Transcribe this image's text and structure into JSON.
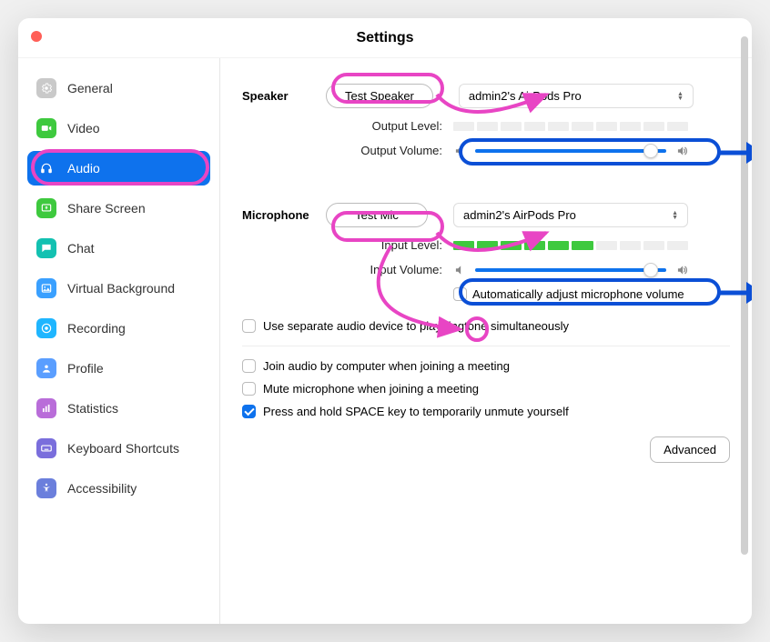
{
  "title": "Settings",
  "sidebar": {
    "items": [
      {
        "label": "General",
        "icon": "gear",
        "color": "#c9c9c9"
      },
      {
        "label": "Video",
        "icon": "video",
        "color": "#3ec93e"
      },
      {
        "label": "Audio",
        "icon": "headphones",
        "color": "#ffffff",
        "active": true
      },
      {
        "label": "Share Screen",
        "icon": "share",
        "color": "#3ec93e"
      },
      {
        "label": "Chat",
        "icon": "chat",
        "color": "#13c1b1"
      },
      {
        "label": "Virtual Background",
        "icon": "image",
        "color": "#3aa0ff"
      },
      {
        "label": "Recording",
        "icon": "record",
        "color": "#1fb6ff"
      },
      {
        "label": "Profile",
        "icon": "profile",
        "color": "#5a9eff"
      },
      {
        "label": "Statistics",
        "icon": "stats",
        "color": "#b96dd9"
      },
      {
        "label": "Keyboard Shortcuts",
        "icon": "keyboard",
        "color": "#7a6edc"
      },
      {
        "label": "Accessibility",
        "icon": "accessibility",
        "color": "#6b7fdc"
      }
    ]
  },
  "speaker": {
    "heading": "Speaker",
    "test_label": "Test Speaker",
    "device": "admin2's AirPods Pro",
    "output_level_label": "Output Level:",
    "output_level_filled": 0,
    "output_volume_label": "Output Volume:",
    "output_volume_percent": 92
  },
  "microphone": {
    "heading": "Microphone",
    "test_label": "Test Mic",
    "device": "admin2's AirPods Pro",
    "input_level_label": "Input Level:",
    "input_level_filled": 6,
    "input_volume_label": "Input Volume:",
    "input_volume_percent": 92,
    "auto_adjust_label": "Automatically adjust microphone volume",
    "auto_adjust_checked": false
  },
  "options": {
    "separate_ringtone_label": "Use separate audio device to play ringtone simultaneously",
    "separate_ringtone_checked": false,
    "join_audio_label": "Join audio by computer when joining a meeting",
    "join_audio_checked": false,
    "mute_on_join_label": "Mute microphone when joining a meeting",
    "mute_on_join_checked": false,
    "space_unmute_label": "Press and hold SPACE key to temporarily unmute yourself",
    "space_unmute_checked": true
  },
  "advanced_label": "Advanced"
}
